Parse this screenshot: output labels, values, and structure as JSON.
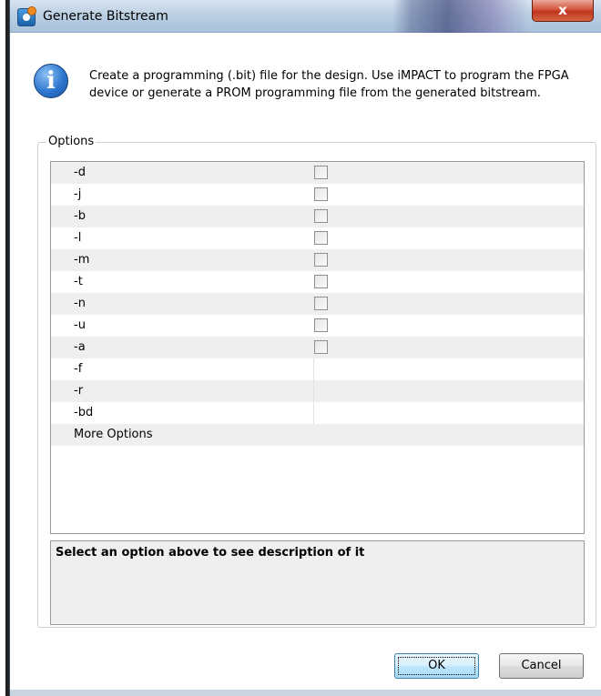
{
  "window": {
    "title": "Generate Bitstream",
    "close_label": "x",
    "app_icon": "xilinx-app-icon"
  },
  "info": {
    "icon": "info-icon",
    "text": "Create a programming (.bit) file for the design. Use iMPACT to program the FPGA device or generate a PROM programming file from the generated bitstream."
  },
  "options": {
    "group_label": "Options",
    "rows": [
      {
        "name": "-d",
        "control": "checkbox",
        "checked": false
      },
      {
        "name": "-j",
        "control": "checkbox",
        "checked": false
      },
      {
        "name": "-b",
        "control": "checkbox",
        "checked": false
      },
      {
        "name": "-l",
        "control": "checkbox",
        "checked": false
      },
      {
        "name": "-m",
        "control": "checkbox",
        "checked": false
      },
      {
        "name": "-t",
        "control": "checkbox",
        "checked": false
      },
      {
        "name": "-n",
        "control": "checkbox",
        "checked": false
      },
      {
        "name": "-u",
        "control": "checkbox",
        "checked": false
      },
      {
        "name": "-a",
        "control": "checkbox",
        "checked": false
      },
      {
        "name": "-f",
        "control": "text",
        "value": ""
      },
      {
        "name": "-r",
        "control": "text",
        "value": ""
      },
      {
        "name": "-bd",
        "control": "text",
        "value": ""
      },
      {
        "name": "More Options",
        "control": "none"
      }
    ]
  },
  "description": {
    "text": "Select an option above to see description of it"
  },
  "buttons": {
    "ok_label": "OK",
    "cancel_label": "Cancel"
  }
}
